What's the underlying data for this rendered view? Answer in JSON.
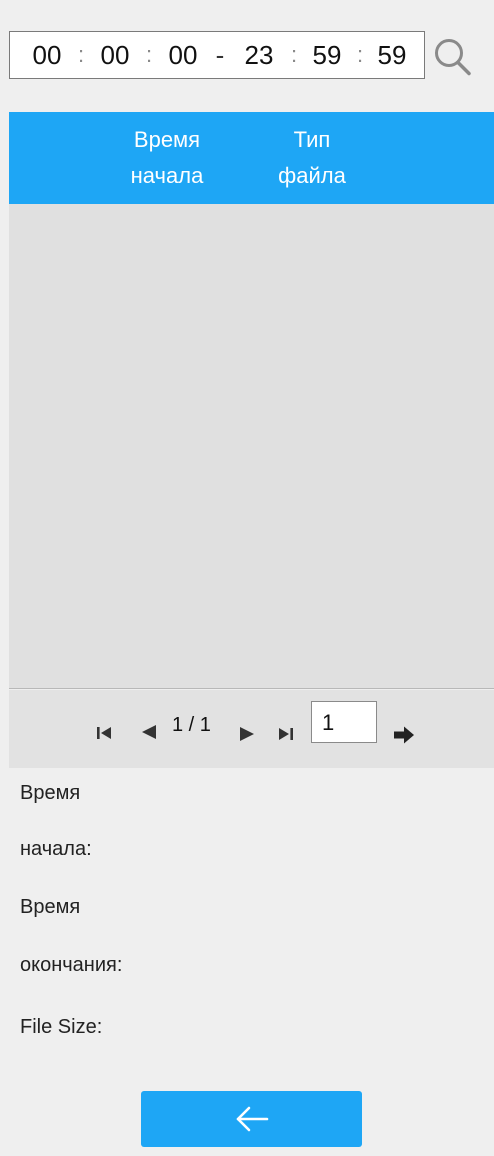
{
  "time_range": {
    "start": {
      "hh": "00",
      "mm": "00",
      "ss": "00"
    },
    "end": {
      "hh": "23",
      "mm": "59",
      "ss": "59"
    },
    "separator": ":",
    "range_dash": "-"
  },
  "table": {
    "columns": [
      {
        "line1": "Время",
        "line2": "начала"
      },
      {
        "line1": "Тип",
        "line2": "файла"
      }
    ],
    "rows": []
  },
  "pagination": {
    "page_text": "1 / 1",
    "page_input_value": "1"
  },
  "details": {
    "start_time_label_1": "Время",
    "start_time_label_2": "начала:",
    "end_time_label_1": "Время",
    "end_time_label_2": "окончания:",
    "file_size_label": "File Size:"
  },
  "icons": {
    "search": "search-icon",
    "first_page": "first-page-icon",
    "prev_page": "prev-page-icon",
    "next_page": "next-page-icon",
    "last_page": "last-page-icon",
    "go": "go-arrow-icon",
    "back": "back-arrow-icon"
  },
  "colors": {
    "accent": "#1ea6f5",
    "background": "#efefef",
    "table_body": "#e0e0e0",
    "pagination_bg": "#e2e2e2"
  }
}
